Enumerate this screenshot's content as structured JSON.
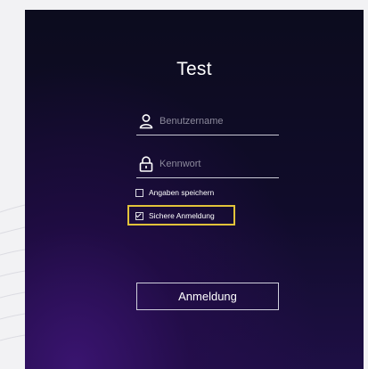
{
  "login": {
    "title": "Test",
    "username": {
      "placeholder": "Benutzername",
      "value": ""
    },
    "password": {
      "placeholder": "Kennwort",
      "value": ""
    },
    "remember": {
      "label": "Angaben speichern",
      "checked": false
    },
    "secure": {
      "label": "Sichere Anmeldung",
      "checked": true
    },
    "submit_label": "Anmeldung"
  },
  "icons": {
    "username": "user-icon",
    "password": "lock-icon"
  },
  "colors": {
    "highlight": "#e2c33a",
    "panel_top": "#0c0c1e",
    "panel_glow": "#3a1470"
  }
}
